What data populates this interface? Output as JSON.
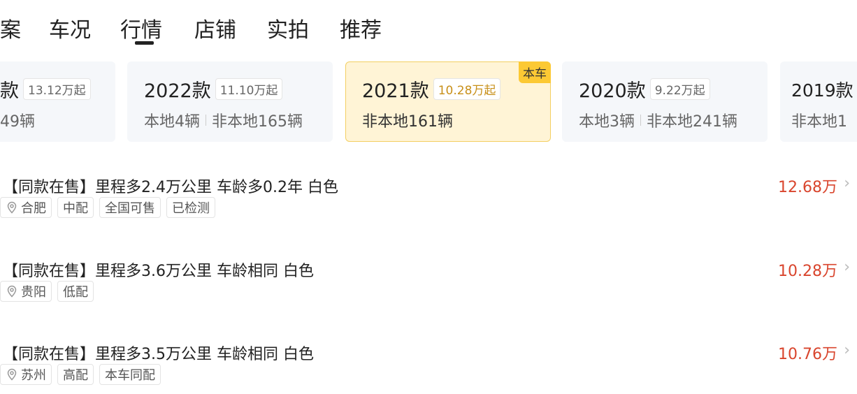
{
  "tabs": [
    {
      "label": "案"
    },
    {
      "label": "车况"
    },
    {
      "label": "行情",
      "active": true
    },
    {
      "label": "店铺"
    },
    {
      "label": "实拍"
    },
    {
      "label": "推荐"
    }
  ],
  "cards": [
    {
      "year": "款",
      "price": "13.12万起",
      "count": "49辆"
    },
    {
      "year": "2022款",
      "price": "11.10万起",
      "local": "本地4辆",
      "nonlocal": "非本地165辆"
    },
    {
      "year": "2021款",
      "price": "10.28万起",
      "nonlocal": "非本地161辆",
      "badge": "本车",
      "current": true
    },
    {
      "year": "2020款",
      "price": "9.22万起",
      "local": "本地3辆",
      "nonlocal": "非本地241辆"
    },
    {
      "year": "2019款",
      "nonlocal": "非本地1"
    }
  ],
  "listings": [
    {
      "title": "【同款在售】里程多2.4万公里 车龄多0.2年 白色",
      "price": "12.68万",
      "city": "合肥",
      "tags": [
        "中配",
        "全国可售",
        "已检测"
      ]
    },
    {
      "title": "【同款在售】里程多3.6万公里 车龄相同 白色",
      "price": "10.28万",
      "city": "贵阳",
      "tags": [
        "低配"
      ]
    },
    {
      "title": "【同款在售】里程多3.5万公里 车龄相同 白色",
      "price": "10.76万",
      "city": "苏州",
      "tags": [
        "高配",
        "本车同配"
      ]
    }
  ],
  "colors": {
    "price": "#d9452d",
    "badge": "#fcc934",
    "current_card": "#fff4d6"
  },
  "icons": {
    "location": "location-pin-icon",
    "chevron": "chevron-right-icon"
  }
}
